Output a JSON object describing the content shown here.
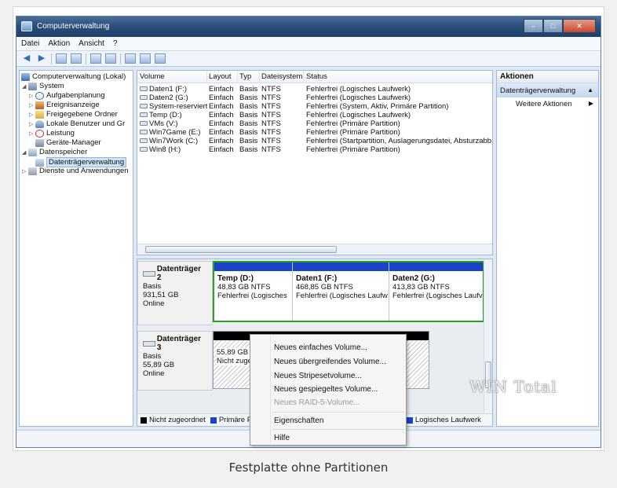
{
  "caption": "Festplatte ohne Partitionen",
  "window": {
    "title": "Computerverwaltung",
    "btn_min": "–",
    "btn_max": "□",
    "btn_close": "✕"
  },
  "menu": {
    "file": "Datei",
    "action": "Aktion",
    "view": "Ansicht",
    "help": "?"
  },
  "tree": {
    "root": "Computerverwaltung (Lokal)",
    "system": "System",
    "tasks": "Aufgabenplanung",
    "events": "Ereignisanzeige",
    "shared": "Freigegebene Ordner",
    "users": "Lokale Benutzer und Gr",
    "perf": "Leistung",
    "devices": "Geräte-Manager",
    "storage": "Datenspeicher",
    "diskmgmt": "Datenträgerverwaltung",
    "services": "Dienste und Anwendungen"
  },
  "volumes": {
    "headers": {
      "volume": "Volume",
      "layout": "Layout",
      "type": "Typ",
      "fs": "Dateisystem",
      "status": "Status"
    },
    "rows": [
      {
        "volume": "Daten1 (F:)",
        "layout": "Einfach",
        "type": "Basis",
        "fs": "NTFS",
        "status": "Fehlerfrei (Logisches Laufwerk)"
      },
      {
        "volume": "Daten2 (G:)",
        "layout": "Einfach",
        "type": "Basis",
        "fs": "NTFS",
        "status": "Fehlerfrei (Logisches Laufwerk)"
      },
      {
        "volume": "System-reserviert",
        "layout": "Einfach",
        "type": "Basis",
        "fs": "NTFS",
        "status": "Fehlerfrei (System, Aktiv, Primäre Partition)"
      },
      {
        "volume": "Temp (D:)",
        "layout": "Einfach",
        "type": "Basis",
        "fs": "NTFS",
        "status": "Fehlerfrei (Logisches Laufwerk)"
      },
      {
        "volume": "VMs (V:)",
        "layout": "Einfach",
        "type": "Basis",
        "fs": "NTFS",
        "status": "Fehlerfrei (Primäre Partition)"
      },
      {
        "volume": "Win7Game (E:)",
        "layout": "Einfach",
        "type": "Basis",
        "fs": "NTFS",
        "status": "Fehlerfrei (Primäre Partition)"
      },
      {
        "volume": "Win7Work (C:)",
        "layout": "Einfach",
        "type": "Basis",
        "fs": "NTFS",
        "status": "Fehlerfrei (Startpartition, Auslagerungsdatei, Absturzabbild"
      },
      {
        "volume": "Win8 (H:)",
        "layout": "Einfach",
        "type": "Basis",
        "fs": "NTFS",
        "status": "Fehlerfrei (Primäre Partition)"
      }
    ]
  },
  "disk2": {
    "name": "Datenträger 2",
    "kind": "Basis",
    "size": "931,51 GB",
    "state": "Online",
    "parts": [
      {
        "name": "Temp (D:)",
        "size": "48,83 GB NTFS",
        "status": "Fehlerfrei (Logisches"
      },
      {
        "name": "Daten1 (F:)",
        "size": "468,85 GB NTFS",
        "status": "Fehlerfrei (Logisches Laufw"
      },
      {
        "name": "Daten2 (G:)",
        "size": "413,83 GB NTFS",
        "status": "Fehlerfrei (Logisches Laufv"
      }
    ]
  },
  "disk3": {
    "name": "Datenträger 3",
    "kind": "Basis",
    "size": "55,89 GB",
    "state": "Online",
    "unalloc_size": "55,89 GB",
    "unalloc_label": "Nicht zugeo"
  },
  "legend": {
    "unallocated": "Nicht zugeordnet",
    "primary": "Primäre Par",
    "logical_prefix": "tz",
    "logical": "Logisches Laufwerk"
  },
  "actions": {
    "header": "Aktionen",
    "group": "Datenträgerverwaltung",
    "more": "Weitere Aktionen"
  },
  "context_menu": {
    "simple": "Neues einfaches Volume...",
    "spanned": "Neues übergreifendes Volume...",
    "striped": "Neues Stripesetvolume...",
    "mirrored": "Neues gespiegeltes Volume...",
    "raid5": "Neues RAID-5-Volume...",
    "properties": "Eigenschaften",
    "help": "Hilfe"
  },
  "watermark": "WIN Total",
  "colors": {
    "partition_bar": "#1a43c8",
    "unallocated_bar": "#000000",
    "selection_border": "#2aa02a"
  }
}
